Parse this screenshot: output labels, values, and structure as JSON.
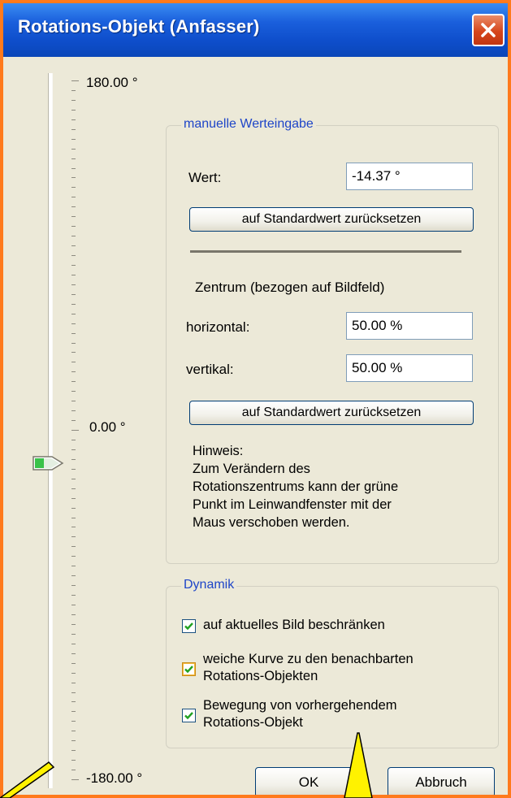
{
  "dialog": {
    "title": "Rotations-Objekt (Anfasser)"
  },
  "slider": {
    "top_label": "180.00 °",
    "middle_label": "0.00 °",
    "bottom_label": "-180.00 °",
    "value_fraction": 0.46
  },
  "manual": {
    "legend": "manuelle Werteingabe",
    "wert_label": "Wert:",
    "wert_value": "-14.37 °",
    "reset_label": "auf Standardwert zurücksetzen",
    "center_heading": "Zentrum (bezogen auf Bildfeld)",
    "horizontal_label": "horizontal:",
    "horizontal_value": "50.00 %",
    "vertical_label": "vertikal:",
    "vertical_value": "50.00 %",
    "reset2_label": "auf Standardwert zurücksetzen",
    "hint": "Hinweis:\nZum Verändern des\nRotationszentrums kann der grüne\nPunkt  im Leinwandfenster mit der\nMaus verschoben werden."
  },
  "dynamic": {
    "legend": "Dynamik",
    "check1_label": "auf aktuelles Bild beschränken",
    "check2_label": "weiche Kurve zu den benachbarten\nRotations-Objekten",
    "check3_label": "Bewegung von vorhergehendem\nRotations-Objekt"
  },
  "buttons": {
    "ok": "OK",
    "cancel": "Abbruch"
  },
  "colors": {
    "title_bar": "#0e4ecb",
    "window_border": "#ff7a1c",
    "legend_text": "#1e45c8",
    "callout": "#fff200"
  }
}
